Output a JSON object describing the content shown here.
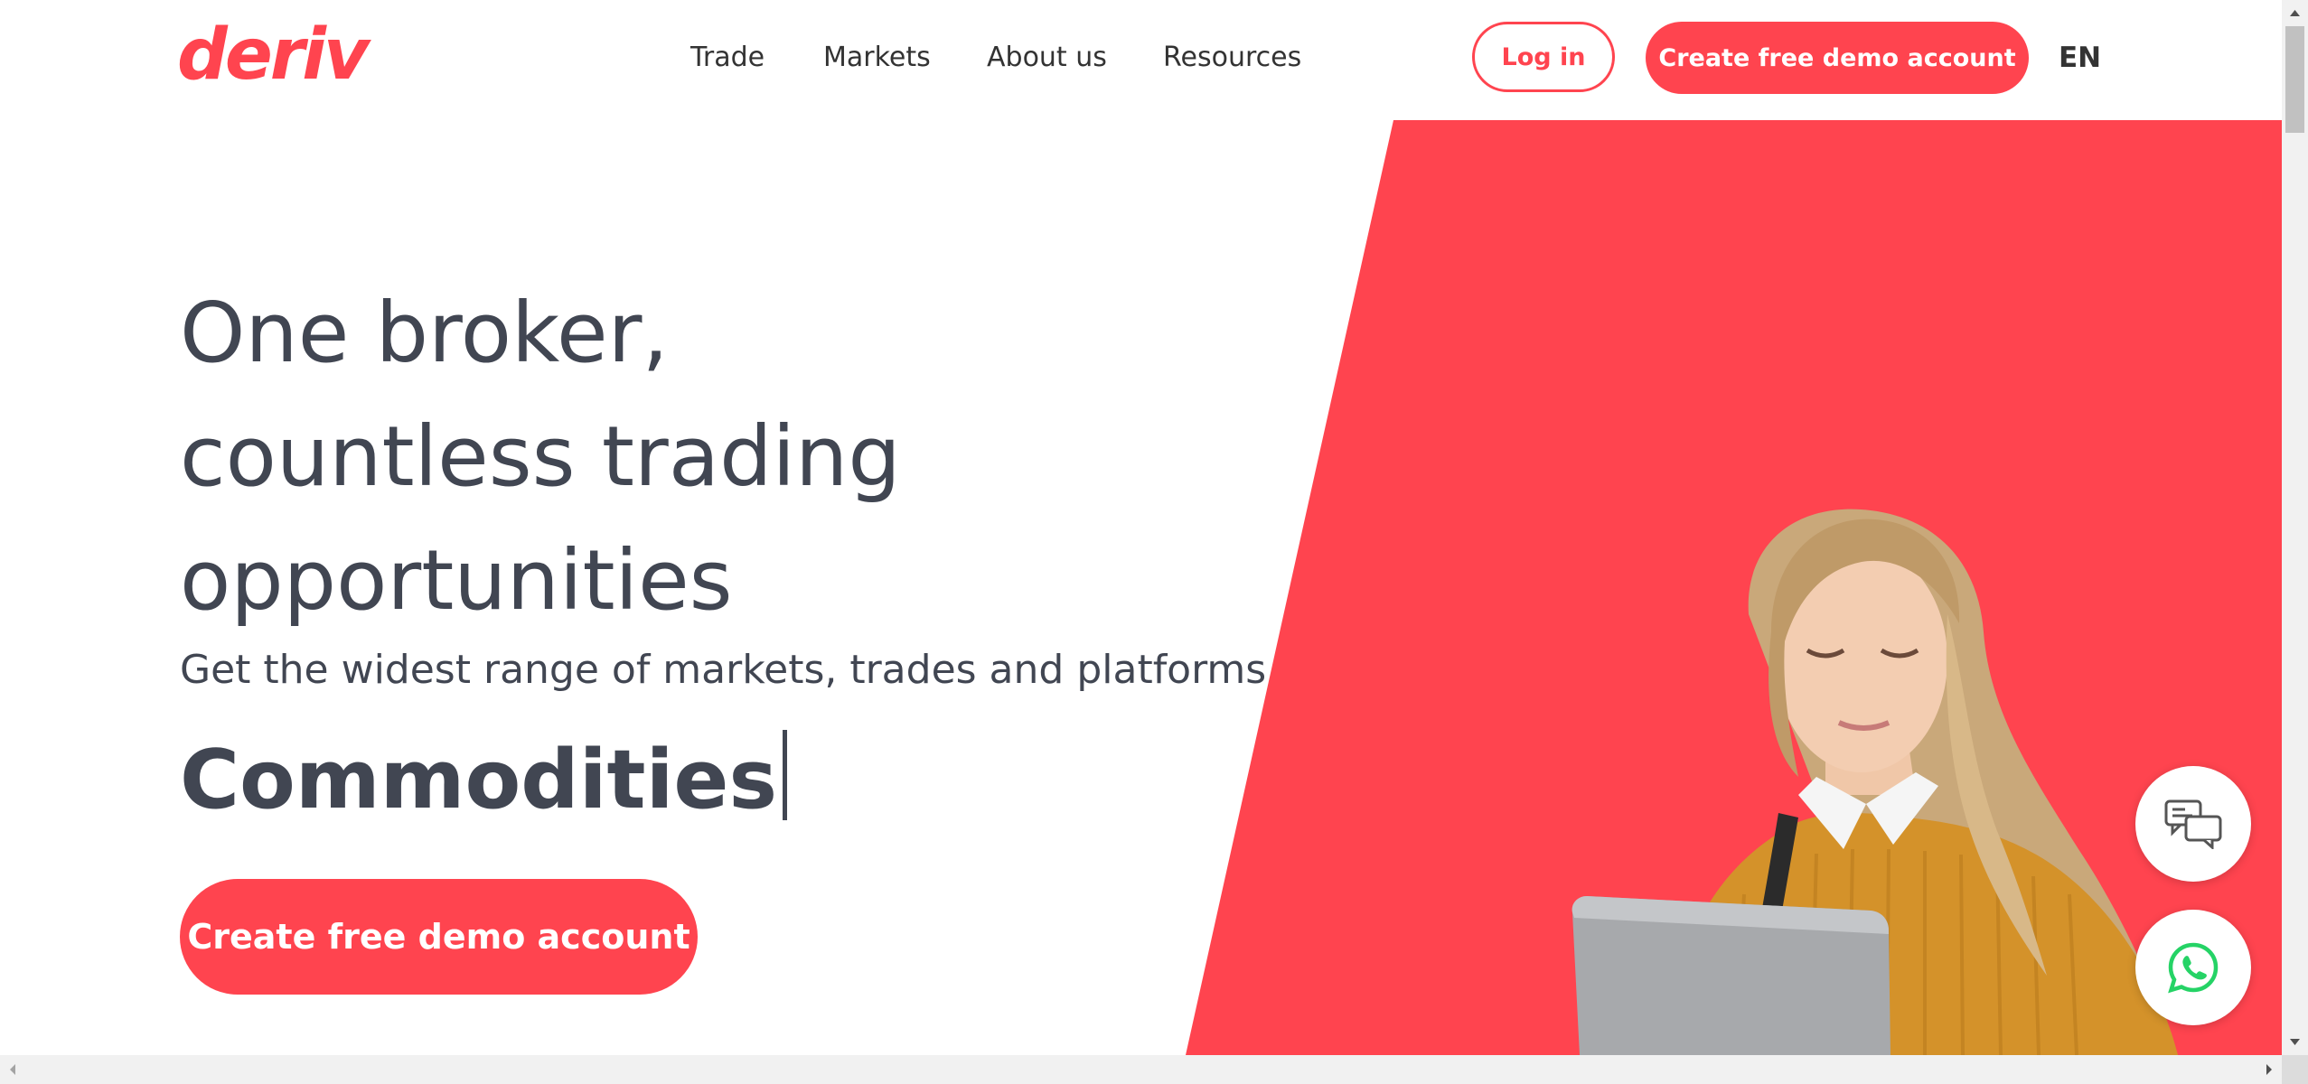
{
  "brand": {
    "logo_text": "deriv",
    "accent_color": "#ff444f",
    "text_color": "#414652"
  },
  "nav": {
    "items": [
      {
        "label": "Trade"
      },
      {
        "label": "Markets"
      },
      {
        "label": "About us"
      },
      {
        "label": "Resources"
      }
    ]
  },
  "header_actions": {
    "login_label": "Log in",
    "signup_label": "Create free demo account",
    "language": "EN"
  },
  "hero": {
    "headline_lines": [
      "One broker,",
      "countless trading",
      "opportunities"
    ],
    "subtitle": "Get the widest range of markets, trades and platforms",
    "typed_word": "Commodities",
    "cta_label": "Create free demo account"
  },
  "floating": {
    "chat_icon": "chat-bubbles-icon",
    "whatsapp_icon": "whatsapp-icon"
  }
}
